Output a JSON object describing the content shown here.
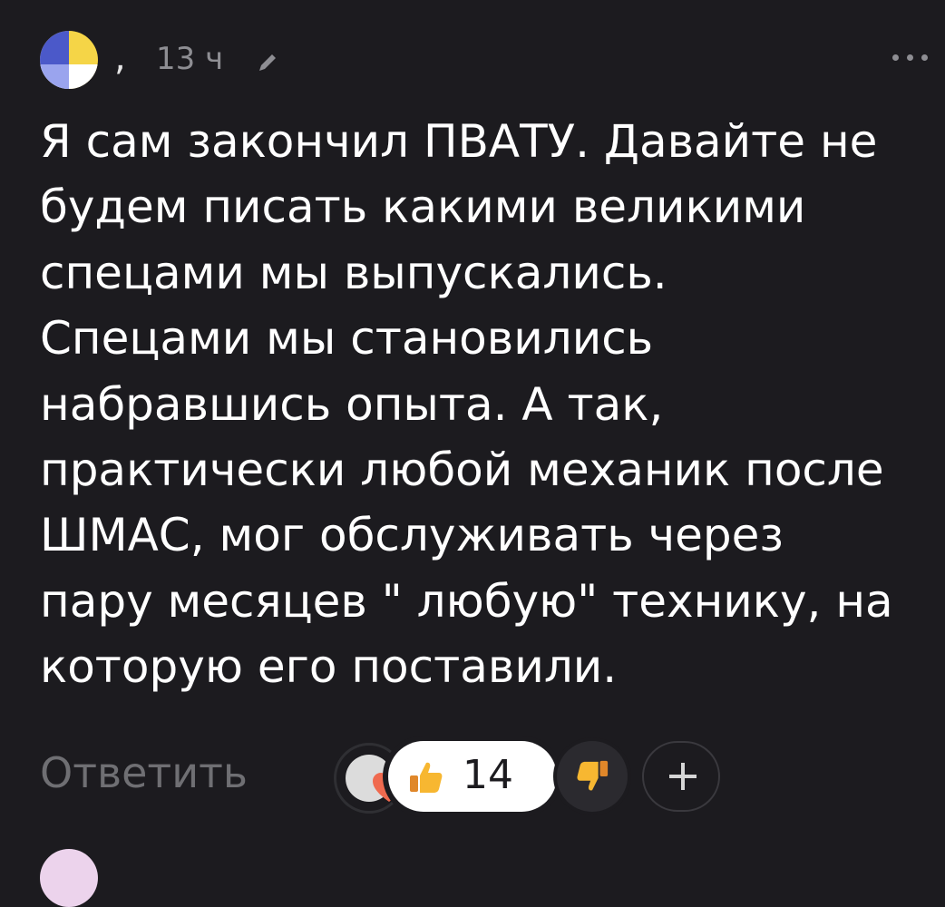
{
  "comment": {
    "separator": ",",
    "time": "13 ч",
    "lines": [
      "Я сам закончил ПВАТУ. Давайте не",
      "будем писать какими великими",
      "спецами мы выпускались.",
      "Спецами мы становились",
      "набравшись опыта. А так,",
      "практически любой механик после",
      "ШМАС, мог обслуживать через",
      "пару месяцев \" любую\" технику, на",
      "которую его поставили."
    ]
  },
  "actions": {
    "reply_label": "Ответить",
    "like_count": "14",
    "like_icon": "thumbs-up-emoji",
    "dislike_icon": "thumbs-down-emoji",
    "add_icon": "plus-icon"
  },
  "colors": {
    "background": "#1c1b1f",
    "text": "#ffffff",
    "muted": "#8e8e93",
    "accent_like": "#ffffff"
  }
}
